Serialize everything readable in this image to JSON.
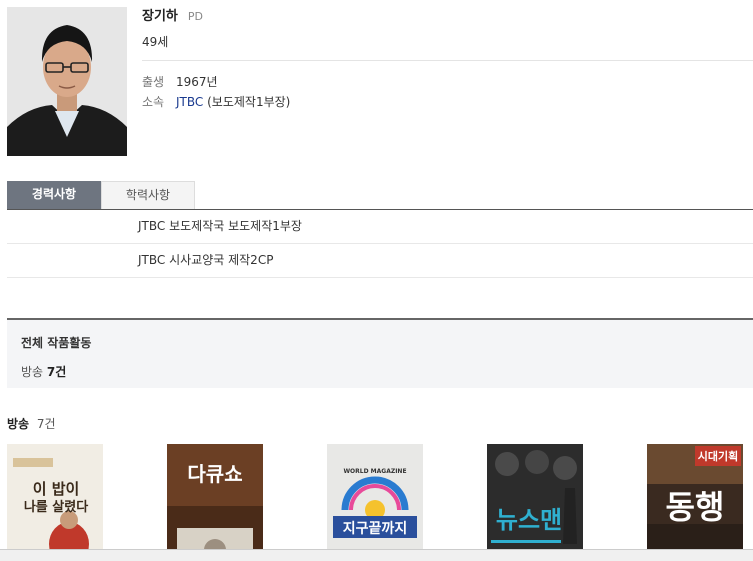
{
  "profile": {
    "name": "장기하",
    "role": "PD",
    "age": "49세",
    "birth_label": "출생",
    "birth_value": "1967년",
    "affiliation_label": "소속",
    "affiliation_link": "JTBC",
    "affiliation_detail": "(보도제작1부장)"
  },
  "tabs": [
    {
      "label": "경력사항",
      "active": true
    },
    {
      "label": "학력사항",
      "active": false
    }
  ],
  "career": [
    "JTBC 보도제작국 보도제작1부장",
    "JTBC 시사교양국 제작2CP"
  ],
  "works_summary": {
    "title": "전체 작품활동",
    "category": "방송",
    "count": "7건"
  },
  "broadcast": {
    "label": "방송",
    "count": "7건"
  },
  "posters": [
    {
      "icon": "poster-bap",
      "line1": "이 밥이",
      "line2": "나를 살렸다"
    },
    {
      "icon": "poster-docu-show",
      "text": "다큐쇼"
    },
    {
      "icon": "poster-world",
      "text": "지구끝까지",
      "small": "WORLD MAGAZINE"
    },
    {
      "icon": "poster-newsman",
      "text": "뉴스맨"
    },
    {
      "icon": "poster-donghaeng",
      "top": "시대기획",
      "text": "동행"
    }
  ],
  "colors": {
    "tab_active": "#6e7580",
    "link": "#1a3a8f",
    "summary_bg": "#f4f5f7"
  }
}
